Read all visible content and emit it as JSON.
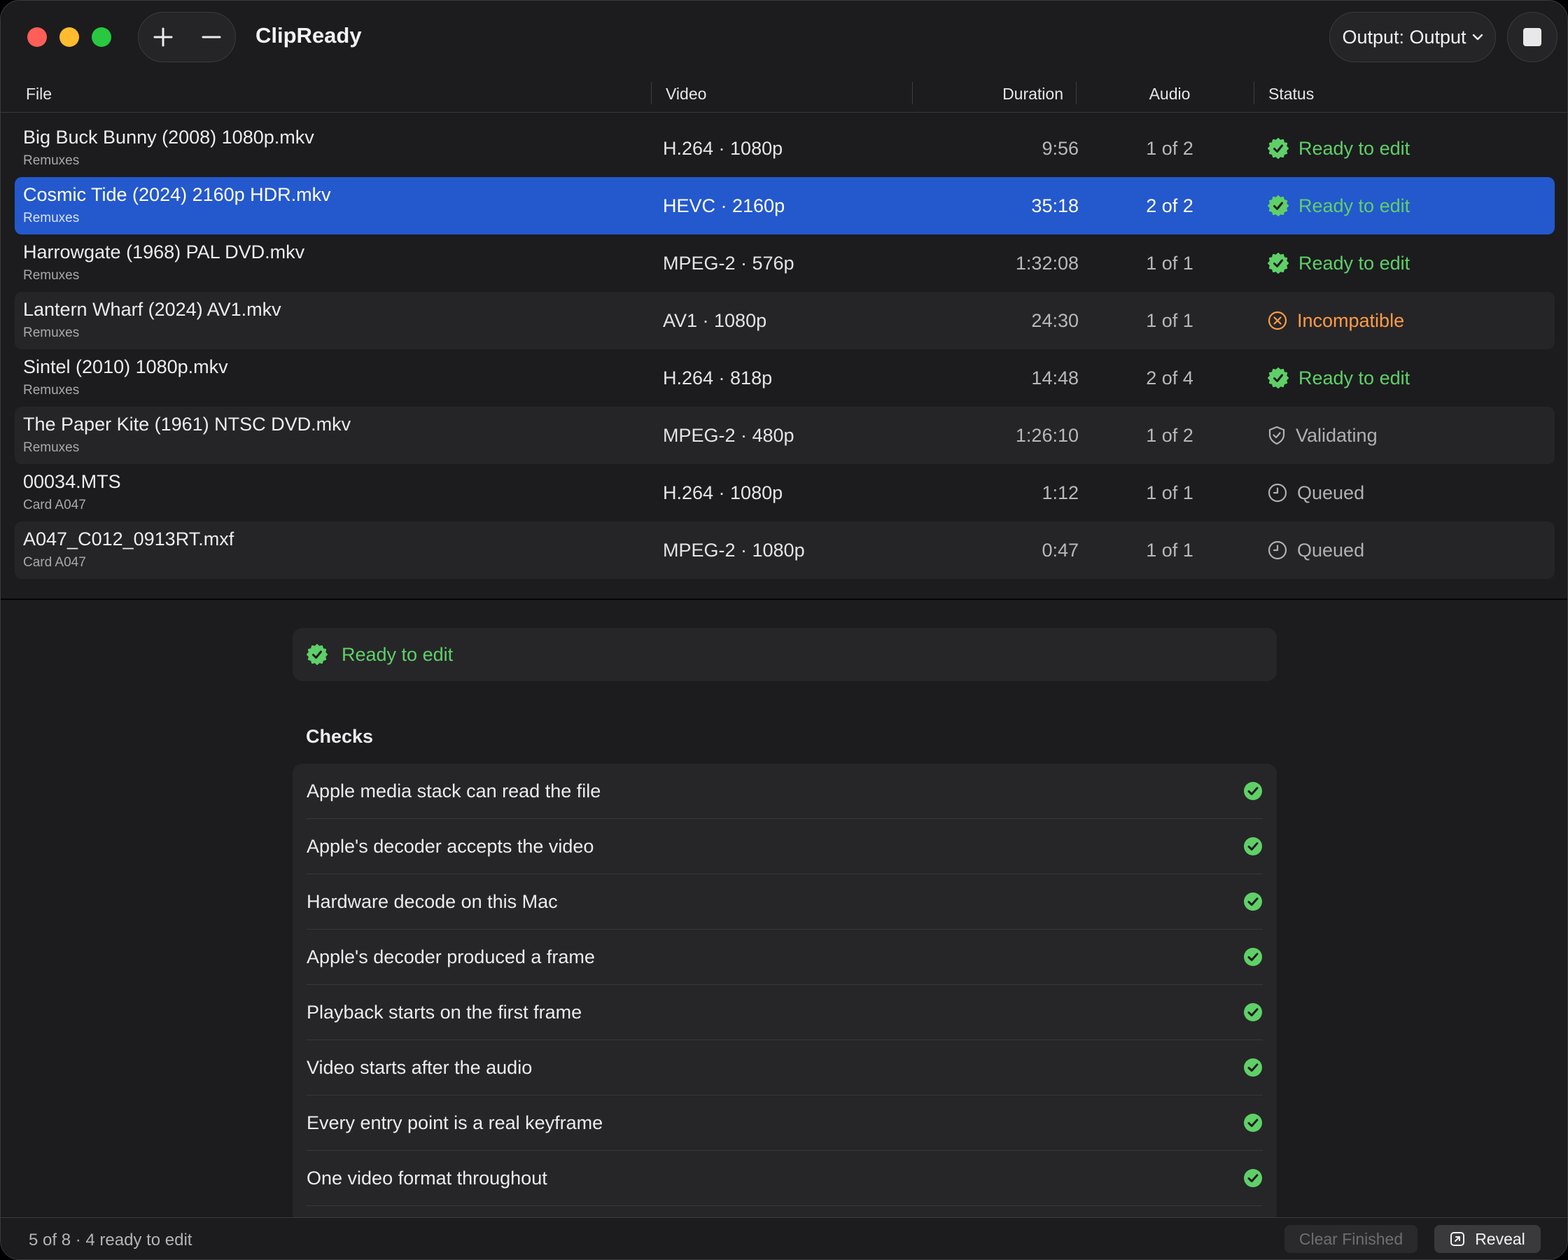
{
  "app": {
    "title": "ClipReady",
    "output_label": "Output: Output",
    "add_icon": "plus-icon",
    "remove_icon": "minus-icon",
    "stop_icon": "stop-icon"
  },
  "columns": {
    "file": "File",
    "video": "Video",
    "duration": "Duration",
    "audio": "Audio",
    "status": "Status"
  },
  "colors": {
    "ready": "#5fd068",
    "incompatible": "#ff9b45",
    "neutral": "#b0b0b4",
    "selection": "#2458cd"
  },
  "rows": [
    {
      "name": "Big Buck Bunny (2008) 1080p.mkv",
      "source": "Remuxes",
      "video": "H.264 · 1080p",
      "duration": "9:56",
      "audio": "1 of 2",
      "status": "Ready to edit",
      "status_icon": "checkmark-seal-icon"
    },
    {
      "name": "Cosmic Tide (2024) 2160p HDR.mkv",
      "source": "Remuxes",
      "video": "HEVC · 2160p",
      "duration": "35:18",
      "audio": "2 of 2",
      "status": "Ready to edit",
      "status_icon": "checkmark-seal-icon",
      "selected": true
    },
    {
      "name": "Harrowgate (1968) PAL DVD.mkv",
      "source": "Remuxes",
      "video": "MPEG-2 · 576p",
      "duration": "1:32:08",
      "audio": "1 of 1",
      "status": "Ready to edit",
      "status_icon": "checkmark-seal-icon"
    },
    {
      "name": "Lantern Wharf (2024) AV1.mkv",
      "source": "Remuxes",
      "video": "AV1 · 1080p",
      "duration": "24:30",
      "audio": "1 of 1",
      "status": "Incompatible",
      "status_icon": "x-circle-icon"
    },
    {
      "name": "Sintel (2010) 1080p.mkv",
      "source": "Remuxes",
      "video": "H.264 · 818p",
      "duration": "14:48",
      "audio": "2 of 4",
      "status": "Ready to edit",
      "status_icon": "checkmark-seal-icon"
    },
    {
      "name": "The Paper Kite (1961) NTSC DVD.mkv",
      "source": "Remuxes",
      "video": "MPEG-2 · 480p",
      "duration": "1:26:10",
      "audio": "1 of 2",
      "status": "Validating",
      "status_icon": "shield-check-icon"
    },
    {
      "name": "00034.MTS",
      "source": "Card A047",
      "video": "H.264 · 1080p",
      "duration": "1:12",
      "audio": "1 of 1",
      "status": "Queued",
      "status_icon": "clock-icon"
    },
    {
      "name": "A047_C012_0913RT.mxf",
      "source": "Card A047",
      "video": "MPEG-2 · 1080p",
      "duration": "0:47",
      "audio": "1 of 1",
      "status": "Queued",
      "status_icon": "clock-icon"
    }
  ],
  "detail": {
    "banner_status": "Ready to edit",
    "checks_title": "Checks",
    "checks": [
      "Apple media stack can read the file",
      "Apple's decoder accepts the video",
      "Hardware decode on this Mac",
      "Apple's decoder produced a frame",
      "Playback starts on the first frame",
      "Video starts after the audio",
      "Every entry point is a real keyframe",
      "One video format throughout"
    ]
  },
  "footer": {
    "status": "5 of 8 · 4 ready to edit",
    "clear_label": "Clear Finished",
    "reveal_label": "Reveal"
  }
}
